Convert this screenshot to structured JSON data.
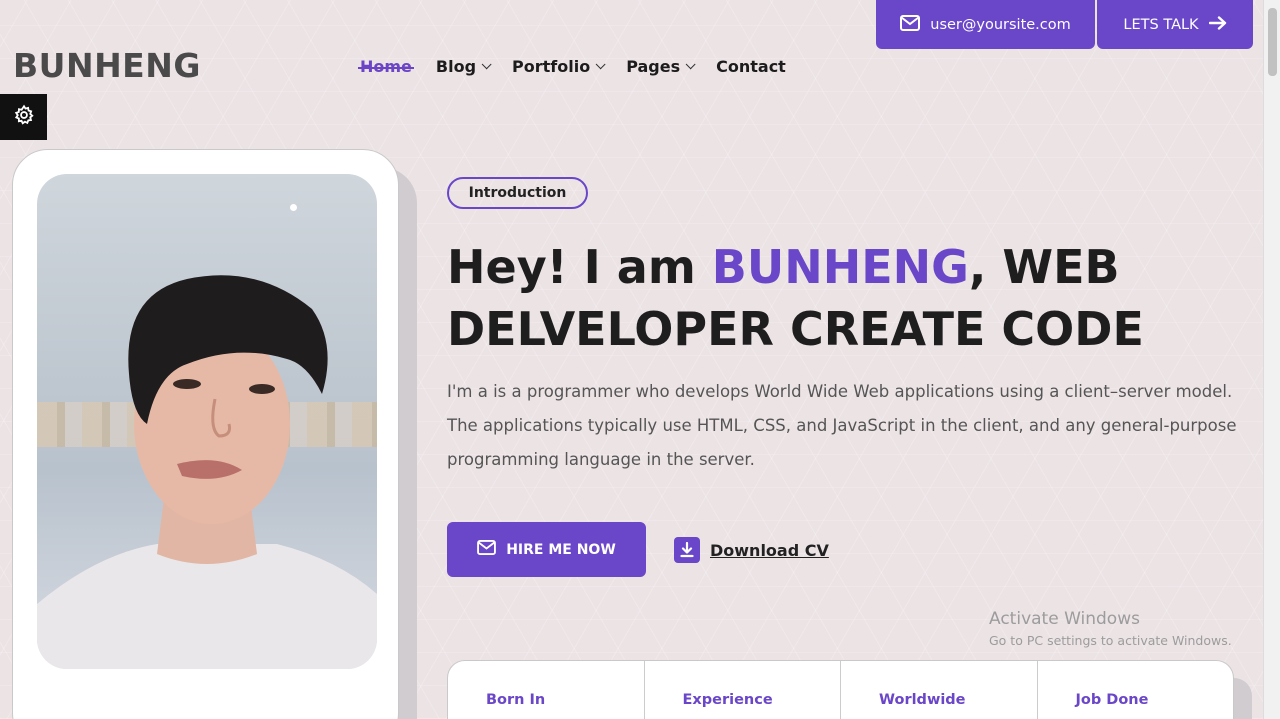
{
  "brand": {
    "name": "BUNHENG"
  },
  "nav": {
    "items": [
      {
        "label": "Home",
        "dropdown": false,
        "active": true
      },
      {
        "label": "Blog",
        "dropdown": true
      },
      {
        "label": "Portfolio",
        "dropdown": true
      },
      {
        "label": "Pages",
        "dropdown": true
      },
      {
        "label": "Contact",
        "dropdown": false
      }
    ]
  },
  "topbar": {
    "email_label": "user@yoursite.com",
    "talk_label": "LETS TALK"
  },
  "hero": {
    "badge": "Introduction",
    "headline_pre": "Hey! I am ",
    "headline_accent": "BUNHENG",
    "headline_post": ", WEB DELVELOPER CREATE CODE",
    "bio": "I'm a is a programmer who develops World Wide Web applications using a client–server model. The applications typically use HTML, CSS, and JavaScript in the client, and any general-purpose programming language in the server.",
    "hire_label": "HIRE ME NOW",
    "download_label": "Download CV"
  },
  "stats": {
    "items": [
      {
        "label": "Born In"
      },
      {
        "label": "Experience"
      },
      {
        "label": "Worldwide"
      },
      {
        "label": "Job Done"
      }
    ]
  },
  "watermark": {
    "line1": "Activate Windows",
    "line2": "Go to PC settings to activate Windows."
  },
  "colors": {
    "accent": "#6a46c8",
    "background": "#ece3e5",
    "dark": "#111111"
  }
}
